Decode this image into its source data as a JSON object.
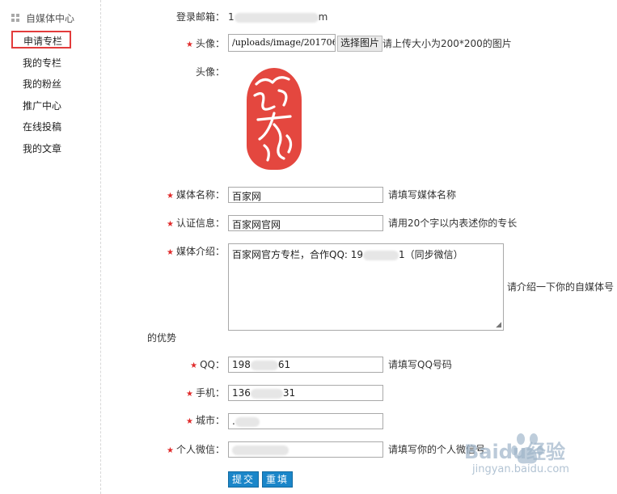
{
  "sidebar": {
    "title": "自媒体中心",
    "items": [
      {
        "label": "申请专栏",
        "active": true
      },
      {
        "label": "我的专栏"
      },
      {
        "label": "我的粉丝"
      },
      {
        "label": "推广中心"
      },
      {
        "label": "在线投稿"
      },
      {
        "label": "我的文章"
      }
    ]
  },
  "form": {
    "email": {
      "label": "登录邮箱：",
      "value_start": "1",
      "value_end": "m"
    },
    "avatar_upload": {
      "label": "头像：",
      "path": "/uploads/image/201706",
      "button": "选择图片",
      "hint": "请上传大小为200*200的图片"
    },
    "avatar_preview": {
      "label": "头像："
    },
    "media_name": {
      "label": "媒体名称：",
      "value": "百家网",
      "hint": "请填写媒体名称"
    },
    "certification": {
      "label": "认证信息：",
      "value": "百家网官网",
      "hint": "请用20个字以内表述你的专长"
    },
    "intro": {
      "label": "媒体介绍：",
      "value": "百家网官方专栏，合作QQ: 19",
      "value_tail": "1（同步微信）",
      "hint": "请介绍一下你的自媒体号",
      "hint_wrap": "的优势"
    },
    "qq": {
      "label": "QQ：",
      "value_start": "198",
      "value_end": "61",
      "hint": "请填写QQ号码"
    },
    "phone": {
      "label": "手机：",
      "value_start": "136",
      "value_end": "31"
    },
    "city": {
      "label": "城市：",
      "value": "."
    },
    "wechat": {
      "label": "个人微信：",
      "hint": "请填写你的个人微信号"
    },
    "submit": "提交",
    "reset": "重填"
  },
  "watermark": {
    "brand": "Baidu经验",
    "url": "jingyan.baidu.com"
  },
  "colors": {
    "accent": "#1b86c9",
    "required": "#e02b2b",
    "highlight_box": "#e23b3b",
    "seal": "#e4473f"
  }
}
